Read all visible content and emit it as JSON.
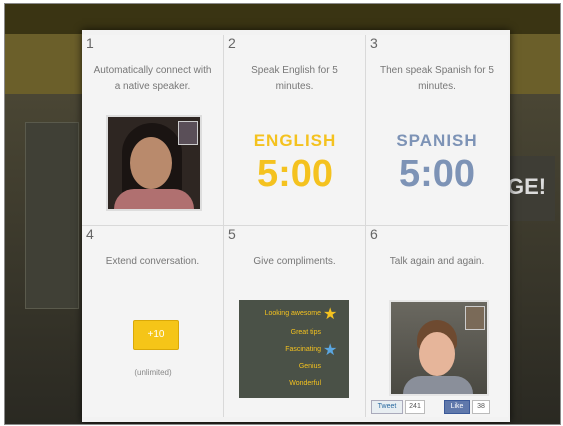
{
  "background": {
    "logo": "",
    "banner_fragment": "GE!"
  },
  "steps": [
    {
      "number": "1",
      "caption": "Automatically connect with a native speaker."
    },
    {
      "number": "2",
      "caption": "Speak English for 5 minutes.",
      "language": "ENGLISH",
      "time": "5:00"
    },
    {
      "number": "3",
      "caption": "Then speak Spanish for 5 minutes.",
      "language": "SPANISH",
      "time": "5:00"
    },
    {
      "number": "4",
      "caption": "Extend conversation.",
      "button": "+10",
      "sub": "(unlimited)"
    },
    {
      "number": "5",
      "caption": "Give compliments.",
      "compliments": [
        "Looking awesome",
        "Great tips",
        "Fascinating",
        "Genius",
        "Wonderful"
      ]
    },
    {
      "number": "6",
      "caption": "Talk again and again.",
      "tweet_label": "Tweet",
      "tweet_count": "241",
      "like_label": "Like",
      "like_count": "38"
    }
  ],
  "colors": {
    "english": "#f4c21f",
    "spanish": "#7d93b6"
  }
}
